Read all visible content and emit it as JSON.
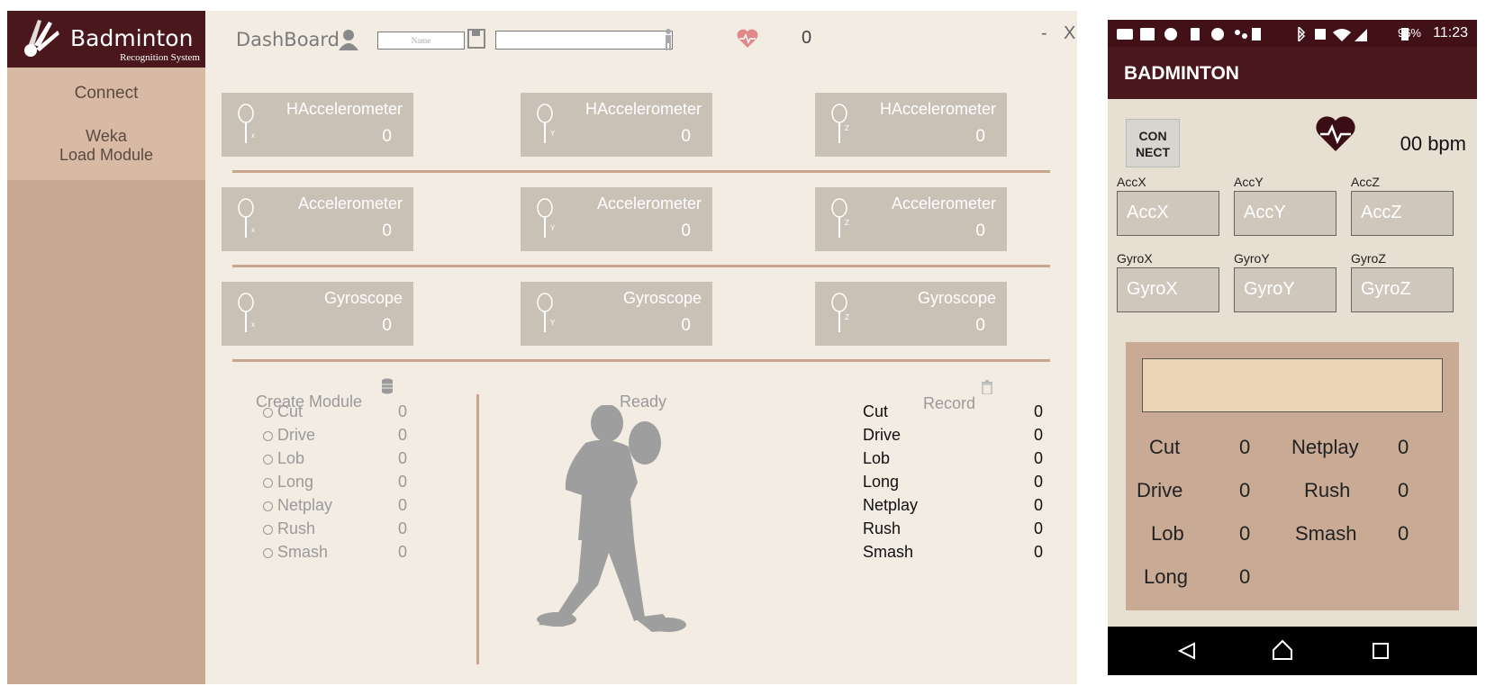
{
  "desktop": {
    "logo": {
      "title": "Badminton",
      "subtitle": "Recognition System"
    },
    "sidebar": {
      "connect": "Connect",
      "weka": "Weka",
      "load_module": "Load Module"
    },
    "topbar": {
      "title": "DashBoard",
      "name_placeholder": "Name",
      "heart_rate": "0",
      "minimize": "-",
      "close": "X"
    },
    "cards": [
      {
        "label": "HAccelerometer",
        "value": "0",
        "axis": "x"
      },
      {
        "label": "HAccelerometer",
        "value": "0",
        "axis": "y"
      },
      {
        "label": "HAccelerometer",
        "value": "0",
        "axis": "z"
      },
      {
        "label": "Accelerometer",
        "value": "0",
        "axis": "x"
      },
      {
        "label": "Accelerometer",
        "value": "0",
        "axis": "y"
      },
      {
        "label": "Accelerometer",
        "value": "0",
        "axis": "z"
      },
      {
        "label": "Gyroscope",
        "value": "0",
        "axis": "x"
      },
      {
        "label": "Gyroscope",
        "value": "0",
        "axis": "y"
      },
      {
        "label": "Gyroscope",
        "value": "0",
        "axis": "z"
      }
    ],
    "create_module": {
      "title": "Create Module",
      "rows": [
        {
          "name": "Cut",
          "value": "0"
        },
        {
          "name": "Drive",
          "value": "0"
        },
        {
          "name": "Lob",
          "value": "0"
        },
        {
          "name": "Long",
          "value": "0"
        },
        {
          "name": "Netplay",
          "value": "0"
        },
        {
          "name": "Rush",
          "value": "0"
        },
        {
          "name": "Smash",
          "value": "0"
        }
      ]
    },
    "status": "Ready",
    "record": {
      "title": "Record",
      "rows": [
        {
          "name": "Cut",
          "value": "0"
        },
        {
          "name": "Drive",
          "value": "0"
        },
        {
          "name": "Lob",
          "value": "0"
        },
        {
          "name": "Long",
          "value": "0"
        },
        {
          "name": "Netplay",
          "value": "0"
        },
        {
          "name": "Rush",
          "value": "0"
        },
        {
          "name": "Smash",
          "value": "0"
        }
      ]
    }
  },
  "phone": {
    "status_bar": {
      "battery": "96%",
      "time": "11:23"
    },
    "app_title": "BADMINTON",
    "connect_line1": "CON",
    "connect_line2": "NECT",
    "bpm": "00 bpm",
    "sensors": [
      {
        "label": "AccX",
        "value": "AccX"
      },
      {
        "label": "AccY",
        "value": "AccY"
      },
      {
        "label": "AccZ",
        "value": "AccZ"
      },
      {
        "label": "GyroX",
        "value": "GyroX"
      },
      {
        "label": "GyroY",
        "value": "GyroY"
      },
      {
        "label": "GyroZ",
        "value": "GyroZ"
      }
    ],
    "counts": [
      {
        "name": "Cut",
        "value": "0"
      },
      {
        "name": "Netplay",
        "value": "0"
      },
      {
        "name": "Drive",
        "value": "0"
      },
      {
        "name": "Rush",
        "value": "0"
      },
      {
        "name": "Lob",
        "value": "0"
      },
      {
        "name": "Smash",
        "value": "0"
      },
      {
        "name": "Long",
        "value": "0"
      }
    ]
  },
  "colors": {
    "brand_dark": "#4a171d",
    "sidebar": "#c8a892",
    "card": "#c9c1b6",
    "separator": "#c9a58d",
    "heart": "#e0888a"
  }
}
